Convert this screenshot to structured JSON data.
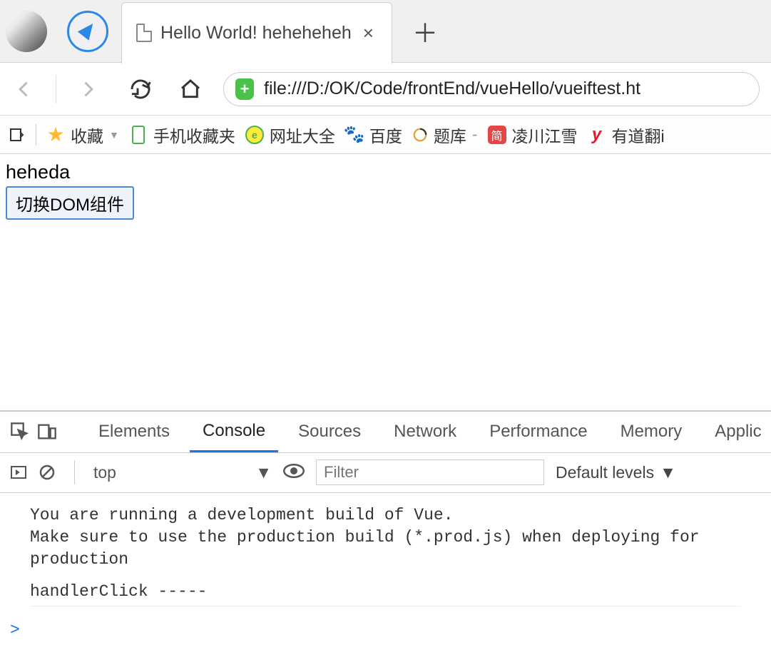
{
  "tab": {
    "title": "Hello World! heheheheh"
  },
  "url": "file:///D:/OK/Code/frontEnd/vueHello/vueiftest.ht",
  "bookmarks": {
    "fav": "收藏",
    "mobile_fav": "手机收藏夹",
    "urls": "网址大全",
    "baidu": "百度",
    "tiku": "题库",
    "lingchuan": "凌川江雪",
    "youdao": "有道翻i",
    "jian": "简"
  },
  "page": {
    "text": "heheda",
    "button": "切换DOM组件"
  },
  "devtools": {
    "tabs": {
      "elements": "Elements",
      "console": "Console",
      "sources": "Sources",
      "network": "Network",
      "performance": "Performance",
      "memory": "Memory",
      "application": "Applic"
    },
    "context": "top",
    "filter_placeholder": "Filter",
    "levels": "Default levels",
    "logs": {
      "line1": "You are running a development build of Vue.",
      "line2": "Make sure to use the production build (*.prod.js) when deploying for production",
      "line3": "handlerClick -----"
    },
    "prompt": ">"
  }
}
